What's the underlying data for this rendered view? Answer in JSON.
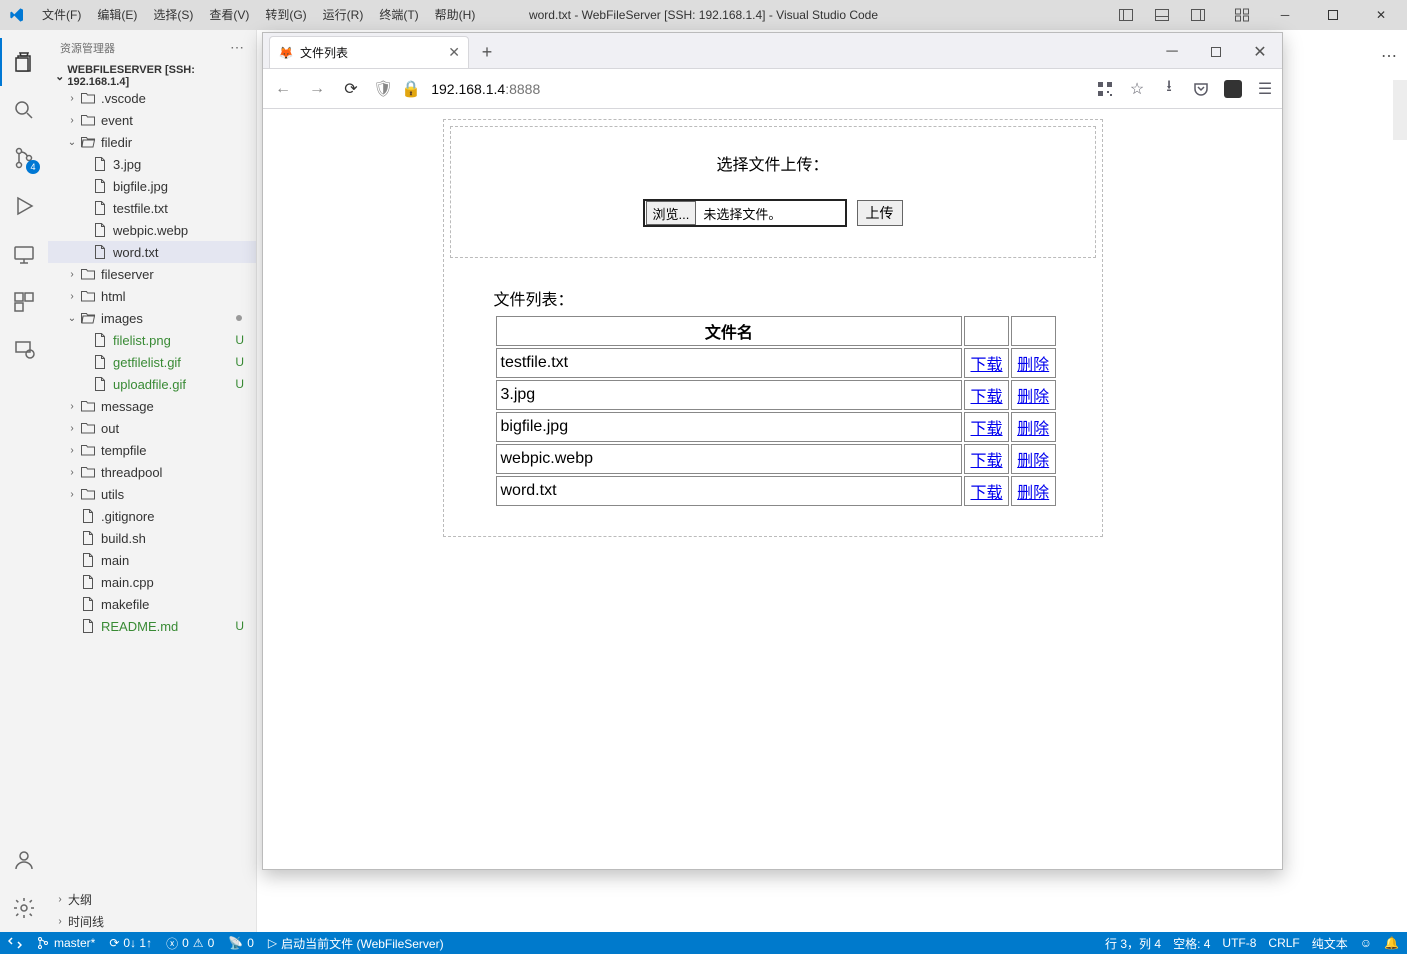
{
  "titlebar": {
    "menu": [
      "文件(F)",
      "编辑(E)",
      "选择(S)",
      "查看(V)",
      "转到(G)",
      "运行(R)",
      "终端(T)",
      "帮助(H)"
    ],
    "title": "word.txt - WebFileServer [SSH: 192.168.1.4] - Visual Studio Code"
  },
  "activitybar": {
    "scm_badge": "4"
  },
  "sidebar": {
    "header": "资源管理器",
    "project": "WEBFILESERVER [SSH: 192.168.1.4]",
    "tree": [
      {
        "type": "folder",
        "name": ".vscode",
        "indent": 1,
        "expanded": false
      },
      {
        "type": "folder",
        "name": "event",
        "indent": 1,
        "expanded": false
      },
      {
        "type": "folder",
        "name": "filedir",
        "indent": 1,
        "expanded": true
      },
      {
        "type": "file",
        "name": "3.jpg",
        "indent": 2
      },
      {
        "type": "file",
        "name": "bigfile.jpg",
        "indent": 2
      },
      {
        "type": "file",
        "name": "testfile.txt",
        "indent": 2
      },
      {
        "type": "file",
        "name": "webpic.webp",
        "indent": 2
      },
      {
        "type": "file",
        "name": "word.txt",
        "indent": 2,
        "selected": true
      },
      {
        "type": "folder",
        "name": "fileserver",
        "indent": 1,
        "expanded": false
      },
      {
        "type": "folder",
        "name": "html",
        "indent": 1,
        "expanded": false
      },
      {
        "type": "folder",
        "name": "images",
        "indent": 1,
        "expanded": true,
        "dot": true
      },
      {
        "type": "file",
        "name": "filelist.png",
        "indent": 2,
        "status": "U",
        "git": true
      },
      {
        "type": "file",
        "name": "getfilelist.gif",
        "indent": 2,
        "status": "U",
        "git": true
      },
      {
        "type": "file",
        "name": "uploadfile.gif",
        "indent": 2,
        "status": "U",
        "git": true
      },
      {
        "type": "folder",
        "name": "message",
        "indent": 1,
        "expanded": false
      },
      {
        "type": "folder",
        "name": "out",
        "indent": 1,
        "expanded": false
      },
      {
        "type": "folder",
        "name": "tempfile",
        "indent": 1,
        "expanded": false
      },
      {
        "type": "folder",
        "name": "threadpool",
        "indent": 1,
        "expanded": false
      },
      {
        "type": "folder",
        "name": "utils",
        "indent": 1,
        "expanded": false
      },
      {
        "type": "file",
        "name": ".gitignore",
        "indent": 1
      },
      {
        "type": "file",
        "name": "build.sh",
        "indent": 1
      },
      {
        "type": "file",
        "name": "main",
        "indent": 1
      },
      {
        "type": "file",
        "name": "main.cpp",
        "indent": 1
      },
      {
        "type": "file",
        "name": "makefile",
        "indent": 1
      },
      {
        "type": "file",
        "name": "README.md",
        "indent": 1,
        "status": "U",
        "git": true
      }
    ],
    "bottom": [
      "大纲",
      "时间线"
    ]
  },
  "browser": {
    "tab_title": "文件列表",
    "url_host": "192.168.1.4",
    "url_port": ":8888",
    "upload_label": "选择文件上传：",
    "browse_btn": "浏览...",
    "no_file": "未选择文件。",
    "upload_btn": "上传",
    "list_label": "文件列表：",
    "table_header": "文件名",
    "download_label": "下载",
    "delete_label": "删除",
    "files": [
      "testfile.txt",
      "3.jpg",
      "bigfile.jpg",
      "webpic.webp",
      "word.txt"
    ]
  },
  "statusbar": {
    "branch": "master*",
    "sync": "0↓ 1↑",
    "errors": "0",
    "warnings": "0",
    "ports": "0",
    "launch": "启动当前文件 (WebFileServer)",
    "position": "行 3，列 4",
    "spaces": "空格: 4",
    "encoding": "UTF-8",
    "eol": "CRLF",
    "lang": "纯文本"
  }
}
